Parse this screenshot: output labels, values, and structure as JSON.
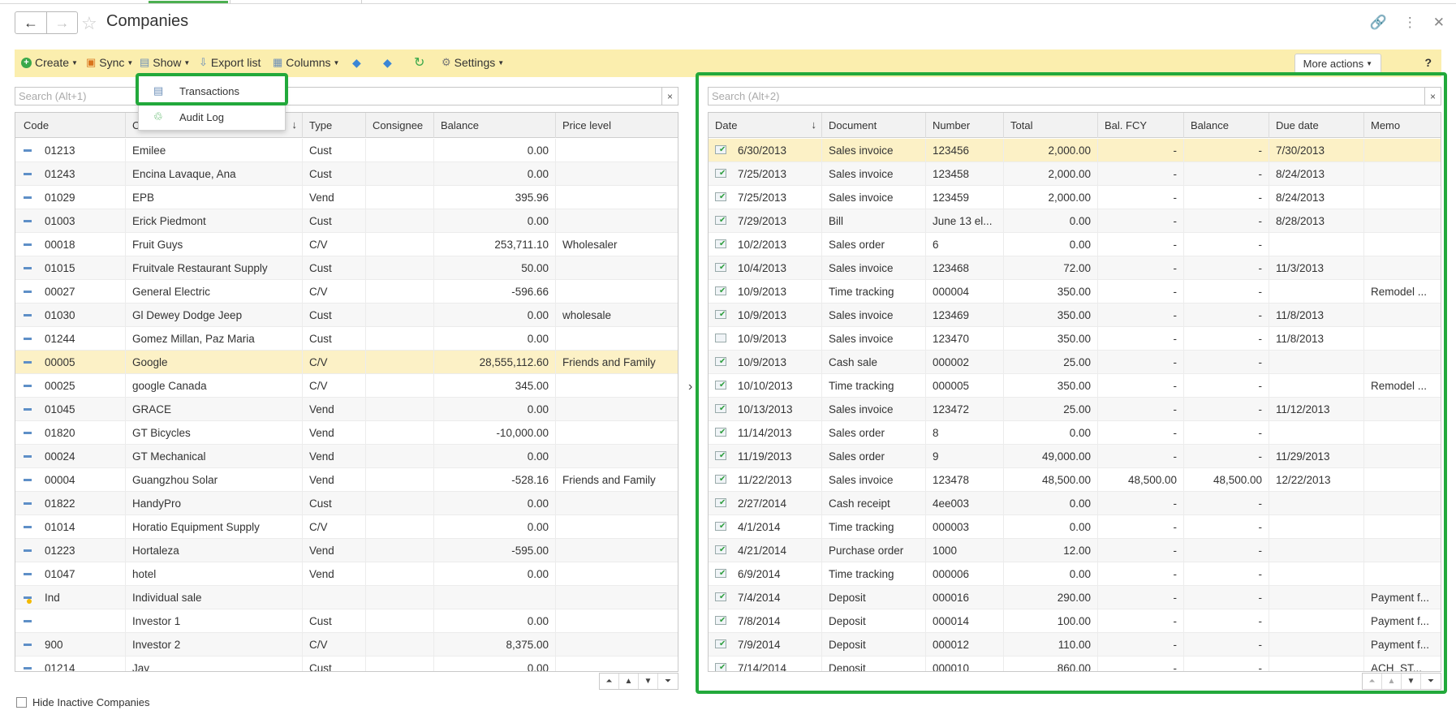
{
  "window": {
    "title": "Companies",
    "back_icon": "←",
    "forward_icon": "→",
    "star_icon": "☆",
    "link_icon": "🔗",
    "menu_icon": "⋮",
    "close_icon": "✕"
  },
  "toolbar": {
    "create": "Create",
    "sync": "Sync",
    "show": "Show",
    "export_list": "Export list",
    "columns": "Columns",
    "settings": "Settings",
    "more_actions": "More actions",
    "help": "?"
  },
  "show_menu": {
    "items": [
      "Transactions",
      "Audit Log"
    ]
  },
  "left": {
    "search_placeholder": "Search (Alt+1)",
    "clear": "×",
    "columns": [
      "Code",
      "C",
      "Type",
      "Consignee",
      "Balance",
      "Price level"
    ],
    "sort_icon": "↓",
    "rows": [
      {
        "code": "01213",
        "name": "Emilee",
        "type": "Cust",
        "consignee": "",
        "balance": "0.00",
        "price_level": ""
      },
      {
        "code": "01243",
        "name": "Encina Lavaque, Ana",
        "type": "Cust",
        "consignee": "",
        "balance": "0.00",
        "price_level": ""
      },
      {
        "code": "01029",
        "name": "EPB",
        "type": "Vend",
        "consignee": "",
        "balance": "395.96",
        "price_level": ""
      },
      {
        "code": "01003",
        "name": "Erick Piedmont",
        "type": "Cust",
        "consignee": "",
        "balance": "0.00",
        "price_level": ""
      },
      {
        "code": "00018",
        "name": "Fruit Guys",
        "type": "C/V",
        "consignee": "",
        "balance": "253,711.10",
        "price_level": "Wholesaler"
      },
      {
        "code": "01015",
        "name": "Fruitvale Restaurant Supply",
        "type": "Cust",
        "consignee": "",
        "balance": "50.00",
        "price_level": ""
      },
      {
        "code": "00027",
        "name": "General Electric",
        "type": "C/V",
        "consignee": "",
        "balance": "-596.66",
        "price_level": ""
      },
      {
        "code": "01030",
        "name": "Gl Dewey Dodge Jeep",
        "type": "Cust",
        "consignee": "",
        "balance": "0.00",
        "price_level": "wholesale"
      },
      {
        "code": "01244",
        "name": "Gomez Millan, Paz Maria",
        "type": "Cust",
        "consignee": "",
        "balance": "0.00",
        "price_level": ""
      },
      {
        "code": "00005",
        "name": "Google",
        "type": "C/V",
        "consignee": "",
        "balance": "28,555,112.60",
        "price_level": "Friends and Family"
      },
      {
        "code": "00025",
        "name": "google Canada",
        "type": "C/V",
        "consignee": "",
        "balance": "345.00",
        "price_level": ""
      },
      {
        "code": "01045",
        "name": "GRACE",
        "type": "Vend",
        "consignee": "",
        "balance": "0.00",
        "price_level": ""
      },
      {
        "code": "01820",
        "name": "GT Bicycles",
        "type": "Vend",
        "consignee": "",
        "balance": "-10,000.00",
        "price_level": ""
      },
      {
        "code": "00024",
        "name": "GT Mechanical",
        "type": "Vend",
        "consignee": "",
        "balance": "0.00",
        "price_level": ""
      },
      {
        "code": "00004",
        "name": "Guangzhou Solar",
        "type": "Vend",
        "consignee": "",
        "balance": "-528.16",
        "price_level": "Friends and Family"
      },
      {
        "code": "01822",
        "name": "HandyPro",
        "type": "Cust",
        "consignee": "",
        "balance": "0.00",
        "price_level": ""
      },
      {
        "code": "01014",
        "name": "Horatio Equipment Supply",
        "type": "C/V",
        "consignee": "",
        "balance": "0.00",
        "price_level": ""
      },
      {
        "code": "01223",
        "name": "Hortaleza",
        "type": "Vend",
        "consignee": "",
        "balance": "-595.00",
        "price_level": ""
      },
      {
        "code": "01047",
        "name": "hotel",
        "type": "Vend",
        "consignee": "",
        "balance": "0.00",
        "price_level": ""
      },
      {
        "code": "Ind",
        "name": "Individual sale",
        "type": "",
        "consignee": "",
        "balance": "",
        "price_level": ""
      },
      {
        "code": "",
        "name": "Investor 1",
        "type": "Cust",
        "consignee": "",
        "balance": "0.00",
        "price_level": ""
      },
      {
        "code": "900",
        "name": "Investor 2",
        "type": "C/V",
        "consignee": "",
        "balance": "8,375.00",
        "price_level": ""
      },
      {
        "code": "01214",
        "name": "Jay",
        "type": "Cust",
        "consignee": "",
        "balance": "0.00",
        "price_level": ""
      }
    ]
  },
  "right": {
    "search_placeholder": "Search (Alt+2)",
    "clear": "×",
    "columns": [
      "Date",
      "Document",
      "Number",
      "Total",
      "Bal. FCY",
      "Balance",
      "Due date",
      "Memo"
    ],
    "sort_icon": "↓",
    "rows": [
      {
        "date": "6/30/2013",
        "document": "Sales invoice",
        "number": "123456",
        "total": "2,000.00",
        "bal_fcy": "-",
        "balance": "-",
        "due": "7/30/2013",
        "memo": ""
      },
      {
        "date": "7/25/2013",
        "document": "Sales invoice",
        "number": "123458",
        "total": "2,000.00",
        "bal_fcy": "-",
        "balance": "-",
        "due": "8/24/2013",
        "memo": ""
      },
      {
        "date": "7/25/2013",
        "document": "Sales invoice",
        "number": "123459",
        "total": "2,000.00",
        "bal_fcy": "-",
        "balance": "-",
        "due": "8/24/2013",
        "memo": ""
      },
      {
        "date": "7/29/2013",
        "document": "Bill",
        "number": "June 13 el...",
        "total": "0.00",
        "bal_fcy": "-",
        "balance": "-",
        "due": "8/28/2013",
        "memo": ""
      },
      {
        "date": "10/2/2013",
        "document": "Sales order",
        "number": "6",
        "total": "0.00",
        "bal_fcy": "-",
        "balance": "-",
        "due": "",
        "memo": ""
      },
      {
        "date": "10/4/2013",
        "document": "Sales invoice",
        "number": "123468",
        "total": "72.00",
        "bal_fcy": "-",
        "balance": "-",
        "due": "11/3/2013",
        "memo": ""
      },
      {
        "date": "10/9/2013",
        "document": "Time tracking",
        "number": "000004",
        "total": "350.00",
        "bal_fcy": "-",
        "balance": "-",
        "due": "",
        "memo": "Remodel ..."
      },
      {
        "date": "10/9/2013",
        "document": "Sales invoice",
        "number": "123469",
        "total": "350.00",
        "bal_fcy": "-",
        "balance": "-",
        "due": "11/8/2013",
        "memo": ""
      },
      {
        "date": "10/9/2013",
        "document": "Sales invoice",
        "number": "123470",
        "total": "350.00",
        "bal_fcy": "-",
        "balance": "-",
        "due": "11/8/2013",
        "memo": ""
      },
      {
        "date": "10/9/2013",
        "document": "Cash sale",
        "number": "000002",
        "total": "25.00",
        "bal_fcy": "-",
        "balance": "-",
        "due": "",
        "memo": ""
      },
      {
        "date": "10/10/2013",
        "document": "Time tracking",
        "number": "000005",
        "total": "350.00",
        "bal_fcy": "-",
        "balance": "-",
        "due": "",
        "memo": "Remodel ..."
      },
      {
        "date": "10/13/2013",
        "document": "Sales invoice",
        "number": "123472",
        "total": "25.00",
        "bal_fcy": "-",
        "balance": "-",
        "due": "11/12/2013",
        "memo": ""
      },
      {
        "date": "11/14/2013",
        "document": "Sales order",
        "number": "8",
        "total": "0.00",
        "bal_fcy": "-",
        "balance": "-",
        "due": "",
        "memo": ""
      },
      {
        "date": "11/19/2013",
        "document": "Sales order",
        "number": "9",
        "total": "49,000.00",
        "bal_fcy": "-",
        "balance": "-",
        "due": "11/29/2013",
        "memo": ""
      },
      {
        "date": "11/22/2013",
        "document": "Sales invoice",
        "number": "123478",
        "total": "48,500.00",
        "bal_fcy": "48,500.00",
        "balance": "48,500.00",
        "due": "12/22/2013",
        "memo": ""
      },
      {
        "date": "2/27/2014",
        "document": "Cash receipt",
        "number": "4ee003",
        "total": "0.00",
        "bal_fcy": "-",
        "balance": "-",
        "due": "",
        "memo": ""
      },
      {
        "date": "4/1/2014",
        "document": "Time tracking",
        "number": "000003",
        "total": "0.00",
        "bal_fcy": "-",
        "balance": "-",
        "due": "",
        "memo": ""
      },
      {
        "date": "4/21/2014",
        "document": "Purchase order",
        "number": "1000",
        "total": "12.00",
        "bal_fcy": "-",
        "balance": "-",
        "due": "",
        "memo": ""
      },
      {
        "date": "6/9/2014",
        "document": "Time tracking",
        "number": "000006",
        "total": "0.00",
        "bal_fcy": "-",
        "balance": "-",
        "due": "",
        "memo": ""
      },
      {
        "date": "7/4/2014",
        "document": "Deposit",
        "number": "000016",
        "total": "290.00",
        "bal_fcy": "-",
        "balance": "-",
        "due": "",
        "memo": "Payment f..."
      },
      {
        "date": "7/8/2014",
        "document": "Deposit",
        "number": "000014",
        "total": "100.00",
        "bal_fcy": "-",
        "balance": "-",
        "due": "",
        "memo": "Payment f..."
      },
      {
        "date": "7/9/2014",
        "document": "Deposit",
        "number": "000012",
        "total": "110.00",
        "bal_fcy": "-",
        "balance": "-",
        "due": "",
        "memo": "Payment f..."
      },
      {
        "date": "7/14/2014",
        "document": "Deposit",
        "number": "000010",
        "total": "860.00",
        "bal_fcy": "-",
        "balance": "-",
        "due": "",
        "memo": "ACH_ST..."
      }
    ]
  },
  "footer": {
    "hide_inactive": "Hide Inactive Companies"
  },
  "colors": {
    "toolbar_bg": "#fbeeae",
    "selected_row": "#fcf1c6",
    "highlight_green": "#22a93b"
  }
}
